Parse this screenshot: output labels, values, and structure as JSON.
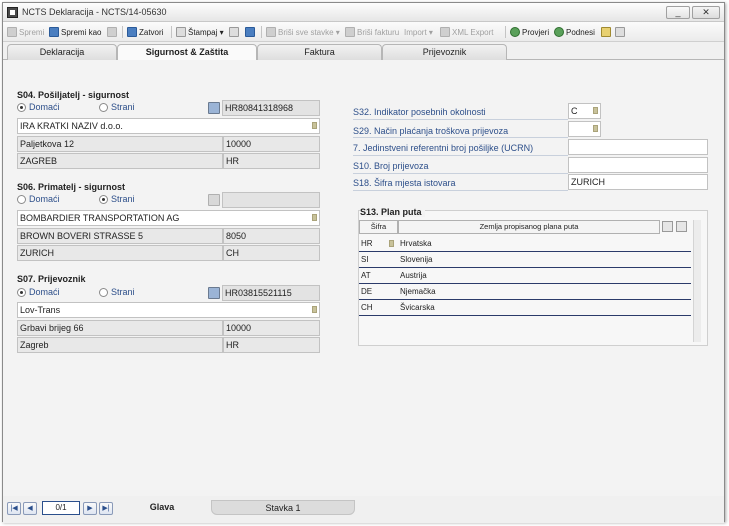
{
  "window": {
    "title": "NCTS Deklaracija - NCTS/14-05630",
    "minimize": "_",
    "close": "✕"
  },
  "toolbar": {
    "spremi": "Spremi",
    "spremi_kao": "Spremi kao",
    "zatvori": "Zatvori",
    "stampaj": "Štampaj ▾",
    "brisi_sve_stavke": "Briši sve stavke ▾",
    "brisi_fakturu": "Briši fakturu",
    "import": "Import ▾",
    "xml_export": "XML Export",
    "provjeri": "Provjeri",
    "podnesi": "Podnesi"
  },
  "tabs": [
    {
      "label": "Deklaracija"
    },
    {
      "label": "Sigurnost & Zaštita"
    },
    {
      "label": "Faktura"
    },
    {
      "label": "Prijevoznik"
    }
  ],
  "s04": {
    "title": "S04. Pošiljatelj - sigurnost",
    "radio_domaci": "Domaći",
    "radio_strani": "Strani",
    "id": "HR80841318968",
    "name": "IRA KRATKI NAZIV d.o.o.",
    "street": "Paljetkova 12",
    "postcode": "10000",
    "city": "ZAGREB",
    "country": "HR"
  },
  "s06": {
    "title": "S06. Primatelj - sigurnost",
    "radio_domaci": "Domaći",
    "radio_strani": "Strani",
    "id": "",
    "name": "BOMBARDIER TRANSPORTATION AG",
    "street": "BROWN BOVERI STRASSE 5",
    "postcode": "8050",
    "city": "ZURICH",
    "country": "CH"
  },
  "s07": {
    "title": "S07. Prijevoznik",
    "radio_domaci": "Domaći",
    "radio_strani": "Strani",
    "id": "HR03815521115",
    "name": "Lov-Trans",
    "street": "Grbavi brijeg 66",
    "postcode": "10000",
    "city": "Zagreb",
    "country": "HR"
  },
  "right": {
    "s32_label": "S32. Indikator posebnih okolnosti",
    "s32_value": "C",
    "s29_label": "S29. Način plaćanja troškova prijevoza",
    "s29_value": "",
    "ucrn_label": "7. Jedinstveni referentni broj pošiljke (UCRN)",
    "ucrn_value": "",
    "s10_label": "S10. Broj prijevoza",
    "s10_value": "",
    "s18_label": "S18. Šifra mjesta istovara",
    "s18_value": "ZURICH"
  },
  "plan": {
    "title": "S13. Plan puta",
    "col_code": "Šifra",
    "col_country": "Zemlja propisanog plana puta",
    "rows": [
      {
        "code": "HR",
        "country": "Hrvatska"
      },
      {
        "code": "SI",
        "country": "Slovenija"
      },
      {
        "code": "AT",
        "country": "Austrija"
      },
      {
        "code": "DE",
        "country": "Njemačka"
      },
      {
        "code": "CH",
        "country": "Švicarska"
      }
    ]
  },
  "status": {
    "pager": "0/1",
    "tab_glava": "Glava",
    "tab_stavka": "Stavka 1"
  }
}
